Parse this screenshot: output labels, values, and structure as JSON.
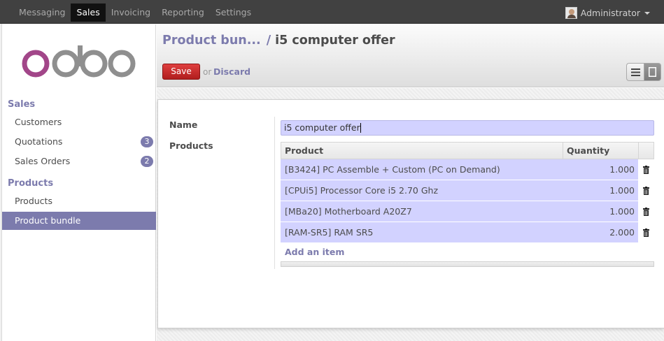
{
  "topbar": {
    "menu": [
      "Messaging",
      "Sales",
      "Invoicing",
      "Reporting",
      "Settings"
    ],
    "active_menu": "Sales",
    "user_name": "Administrator"
  },
  "sidebar": {
    "logo_text": "odoo",
    "sections": [
      {
        "title": "Sales",
        "items": [
          {
            "label": "Customers",
            "badge": ""
          },
          {
            "label": "Quotations",
            "badge": "3"
          },
          {
            "label": "Sales Orders",
            "badge": "2"
          }
        ]
      },
      {
        "title": "Products",
        "items": [
          {
            "label": "Products",
            "badge": ""
          },
          {
            "label": "Product bundle",
            "badge": "",
            "active": true
          }
        ]
      }
    ]
  },
  "header": {
    "breadcrumb_parent": "Product bun...",
    "breadcrumb_sep": "/",
    "breadcrumb_current": "i5 computer offer",
    "save_label": "Save",
    "or_label": "or",
    "discard_label": "Discard"
  },
  "form": {
    "name_label": "Name",
    "name_value": "i5 computer offer",
    "products_label": "Products",
    "columns": [
      "Product",
      "Quantity"
    ],
    "rows": [
      {
        "product": "[B3424] PC Assemble + Custom (PC on Demand)",
        "quantity": "1.000"
      },
      {
        "product": "[CPUi5] Processor Core i5 2.70 Ghz",
        "quantity": "1.000"
      },
      {
        "product": "[MBa20] Motherboard A20Z7",
        "quantity": "1.000"
      },
      {
        "product": "[RAM-SR5] RAM SR5",
        "quantity": "2.000"
      }
    ],
    "add_item_label": "Add an item"
  },
  "colors": {
    "accent": "#7c7bad",
    "topbar": "#414141",
    "save": "#c02c2c",
    "row_highlight": "#d2d2ff"
  }
}
